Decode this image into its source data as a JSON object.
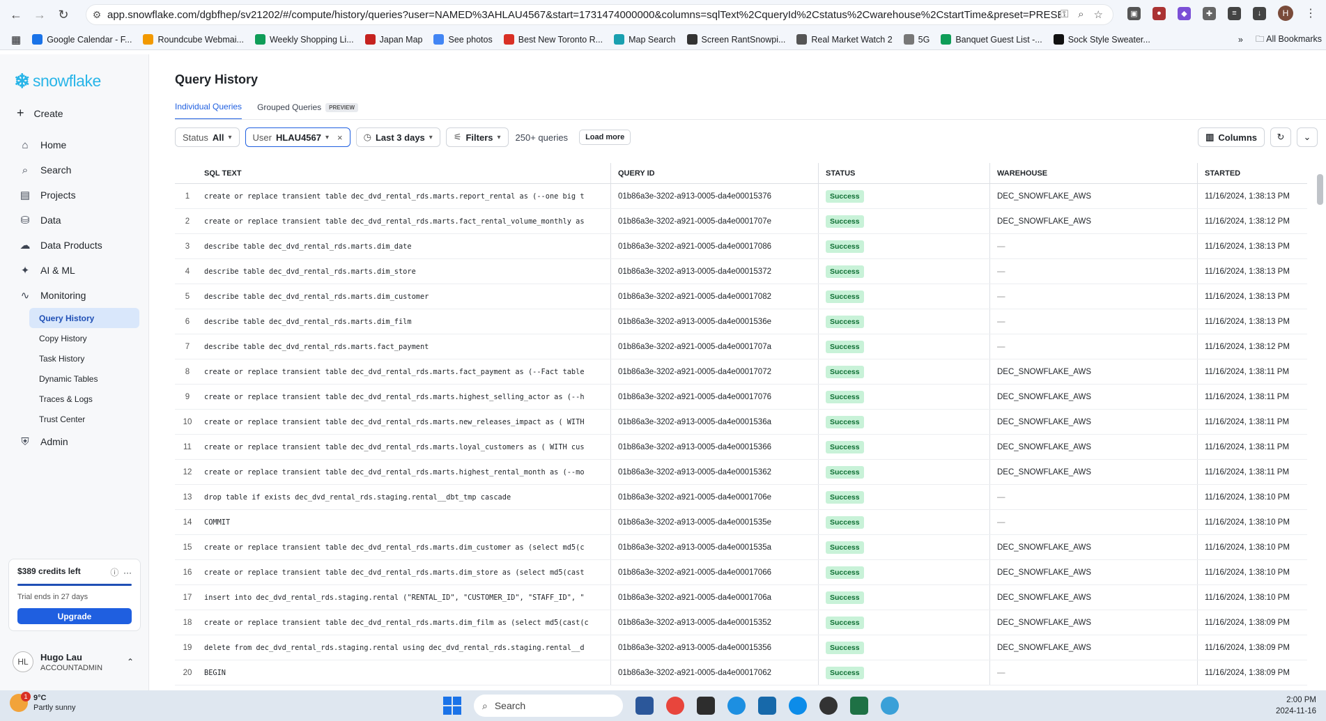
{
  "browser": {
    "url": "app.snowflake.com/dgbfhep/sv21202/#/compute/history/queries?user=NAMED%3AHLAU4567&start=1731474000000&columns=sqlText%2CqueryId%2Cstatus%2Cwarehouse%2CstartTime&preset=PRESET_LAST_3...",
    "profile_initial": "H",
    "bookmarks": [
      {
        "label": "Google Calendar - F...",
        "color": "#1a73e8"
      },
      {
        "label": "Roundcube Webmai...",
        "color": "#f29900"
      },
      {
        "label": "Weekly Shopping Li...",
        "color": "#0f9d58"
      },
      {
        "label": "Japan Map",
        "color": "#c5221f"
      },
      {
        "label": "See photos",
        "color": "#4285f4"
      },
      {
        "label": "Best New Toronto R...",
        "color": "#d93025"
      },
      {
        "label": "Map Search",
        "color": "#1aa0b0"
      },
      {
        "label": "Screen RantSnowpi...",
        "color": "#333333"
      },
      {
        "label": "Real Market Watch 2",
        "color": "#555555"
      },
      {
        "label": "5G",
        "color": "#777777"
      },
      {
        "label": "Banquet Guest List -...",
        "color": "#0f9d58"
      },
      {
        "label": "Sock Style Sweater...",
        "color": "#111111"
      }
    ],
    "all_bookmarks": "All Bookmarks"
  },
  "sidebar": {
    "logo": "snowflake",
    "create": "Create",
    "items": [
      {
        "label": "Home",
        "icon": "⌂"
      },
      {
        "label": "Search",
        "icon": "⌕"
      },
      {
        "label": "Projects",
        "icon": "▤"
      },
      {
        "label": "Data",
        "icon": "⛁"
      },
      {
        "label": "Data Products",
        "icon": "☁"
      },
      {
        "label": "AI & ML",
        "icon": "✦"
      },
      {
        "label": "Monitoring",
        "icon": "∿"
      }
    ],
    "monitoring_sub": [
      "Query History",
      "Copy History",
      "Task History",
      "Dynamic Tables",
      "Traces & Logs",
      "Trust Center"
    ],
    "admin": "Admin",
    "credits": "$389 credits left",
    "trial": "Trial ends in 27 days",
    "upgrade": "Upgrade",
    "user_initials": "HL",
    "user_name": "Hugo Lau",
    "user_role": "ACCOUNTADMIN"
  },
  "page": {
    "title": "Query History",
    "tabs": [
      "Individual Queries",
      "Grouped Queries"
    ],
    "preview_badge": "PREVIEW",
    "filters": {
      "status_label": "Status",
      "status_value": "All",
      "user_label": "User",
      "user_value": "HLAU4567",
      "range": "Last 3 days",
      "filters": "Filters",
      "count": "250+ queries",
      "load_more": "Load more",
      "columns": "Columns"
    }
  },
  "table": {
    "headers": [
      "SQL TEXT",
      "QUERY ID",
      "STATUS",
      "WAREHOUSE",
      "STARTED"
    ],
    "rows": [
      {
        "n": "1",
        "sql": "create or replace transient table dec_dvd_rental_rds.marts.report_rental as (--one big t",
        "qid": "01b86a3e-3202-a913-0005-da4e00015376",
        "status": "Success",
        "wh": "DEC_SNOWFLAKE_AWS",
        "start": "11/16/2024, 1:38:13 PM"
      },
      {
        "n": "2",
        "sql": "create or replace transient table dec_dvd_rental_rds.marts.fact_rental_volume_monthly as",
        "qid": "01b86a3e-3202-a921-0005-da4e0001707e",
        "status": "Success",
        "wh": "DEC_SNOWFLAKE_AWS",
        "start": "11/16/2024, 1:38:12 PM"
      },
      {
        "n": "3",
        "sql": "describe table dec_dvd_rental_rds.marts.dim_date",
        "qid": "01b86a3e-3202-a921-0005-da4e00017086",
        "status": "Success",
        "wh": "—",
        "start": "11/16/2024, 1:38:13 PM"
      },
      {
        "n": "4",
        "sql": "describe table dec_dvd_rental_rds.marts.dim_store",
        "qid": "01b86a3e-3202-a913-0005-da4e00015372",
        "status": "Success",
        "wh": "—",
        "start": "11/16/2024, 1:38:13 PM"
      },
      {
        "n": "5",
        "sql": "describe table dec_dvd_rental_rds.marts.dim_customer",
        "qid": "01b86a3e-3202-a921-0005-da4e00017082",
        "status": "Success",
        "wh": "—",
        "start": "11/16/2024, 1:38:13 PM"
      },
      {
        "n": "6",
        "sql": "describe table dec_dvd_rental_rds.marts.dim_film",
        "qid": "01b86a3e-3202-a913-0005-da4e0001536e",
        "status": "Success",
        "wh": "—",
        "start": "11/16/2024, 1:38:13 PM"
      },
      {
        "n": "7",
        "sql": "describe table dec_dvd_rental_rds.marts.fact_payment",
        "qid": "01b86a3e-3202-a921-0005-da4e0001707a",
        "status": "Success",
        "wh": "—",
        "start": "11/16/2024, 1:38:12 PM"
      },
      {
        "n": "8",
        "sql": "create or replace transient table dec_dvd_rental_rds.marts.fact_payment as (--Fact table",
        "qid": "01b86a3e-3202-a921-0005-da4e00017072",
        "status": "Success",
        "wh": "DEC_SNOWFLAKE_AWS",
        "start": "11/16/2024, 1:38:11 PM"
      },
      {
        "n": "9",
        "sql": "create or replace transient table dec_dvd_rental_rds.marts.highest_selling_actor as (--h",
        "qid": "01b86a3e-3202-a921-0005-da4e00017076",
        "status": "Success",
        "wh": "DEC_SNOWFLAKE_AWS",
        "start": "11/16/2024, 1:38:11 PM"
      },
      {
        "n": "10",
        "sql": "create or replace transient table dec_dvd_rental_rds.marts.new_releases_impact as ( WITH",
        "qid": "01b86a3e-3202-a913-0005-da4e0001536a",
        "status": "Success",
        "wh": "DEC_SNOWFLAKE_AWS",
        "start": "11/16/2024, 1:38:11 PM"
      },
      {
        "n": "11",
        "sql": "create or replace transient table dec_dvd_rental_rds.marts.loyal_customers as ( WITH cus",
        "qid": "01b86a3e-3202-a913-0005-da4e00015366",
        "status": "Success",
        "wh": "DEC_SNOWFLAKE_AWS",
        "start": "11/16/2024, 1:38:11 PM"
      },
      {
        "n": "12",
        "sql": "create or replace transient table dec_dvd_rental_rds.marts.highest_rental_month as (--mo",
        "qid": "01b86a3e-3202-a913-0005-da4e00015362",
        "status": "Success",
        "wh": "DEC_SNOWFLAKE_AWS",
        "start": "11/16/2024, 1:38:11 PM"
      },
      {
        "n": "13",
        "sql": "drop table if exists dec_dvd_rental_rds.staging.rental__dbt_tmp cascade",
        "qid": "01b86a3e-3202-a921-0005-da4e0001706e",
        "status": "Success",
        "wh": "—",
        "start": "11/16/2024, 1:38:10 PM"
      },
      {
        "n": "14",
        "sql": "COMMIT",
        "qid": "01b86a3e-3202-a913-0005-da4e0001535e",
        "status": "Success",
        "wh": "—",
        "start": "11/16/2024, 1:38:10 PM"
      },
      {
        "n": "15",
        "sql": "create or replace transient table dec_dvd_rental_rds.marts.dim_customer as (select md5(c",
        "qid": "01b86a3e-3202-a913-0005-da4e0001535a",
        "status": "Success",
        "wh": "DEC_SNOWFLAKE_AWS",
        "start": "11/16/2024, 1:38:10 PM"
      },
      {
        "n": "16",
        "sql": "create or replace transient table dec_dvd_rental_rds.marts.dim_store as (select md5(cast",
        "qid": "01b86a3e-3202-a921-0005-da4e00017066",
        "status": "Success",
        "wh": "DEC_SNOWFLAKE_AWS",
        "start": "11/16/2024, 1:38:10 PM"
      },
      {
        "n": "17",
        "sql": "insert into dec_dvd_rental_rds.staging.rental (\"RENTAL_ID\", \"CUSTOMER_ID\", \"STAFF_ID\", \"",
        "qid": "01b86a3e-3202-a921-0005-da4e0001706a",
        "status": "Success",
        "wh": "DEC_SNOWFLAKE_AWS",
        "start": "11/16/2024, 1:38:10 PM"
      },
      {
        "n": "18",
        "sql": "create or replace transient table dec_dvd_rental_rds.marts.dim_film as (select md5(cast(c",
        "qid": "01b86a3e-3202-a913-0005-da4e00015352",
        "status": "Success",
        "wh": "DEC_SNOWFLAKE_AWS",
        "start": "11/16/2024, 1:38:09 PM"
      },
      {
        "n": "19",
        "sql": "delete from dec_dvd_rental_rds.staging.rental using dec_dvd_rental_rds.staging.rental__d",
        "qid": "01b86a3e-3202-a913-0005-da4e00015356",
        "status": "Success",
        "wh": "DEC_SNOWFLAKE_AWS",
        "start": "11/16/2024, 1:38:09 PM"
      },
      {
        "n": "20",
        "sql": "BEGIN",
        "qid": "01b86a3e-3202-a921-0005-da4e00017062",
        "status": "Success",
        "wh": "—",
        "start": "11/16/2024, 1:38:09 PM"
      }
    ]
  },
  "taskbar": {
    "temp": "9°C",
    "weather": "Partly sunny",
    "weather_badge": "1",
    "search": "Search",
    "time": "2:00 PM",
    "date": "2024-11-16"
  },
  "colors": {
    "accent": "#1f5fe0",
    "brand": "#29b5e8",
    "success_bg": "#c8f2d8",
    "success_fg": "#0f6e33"
  }
}
